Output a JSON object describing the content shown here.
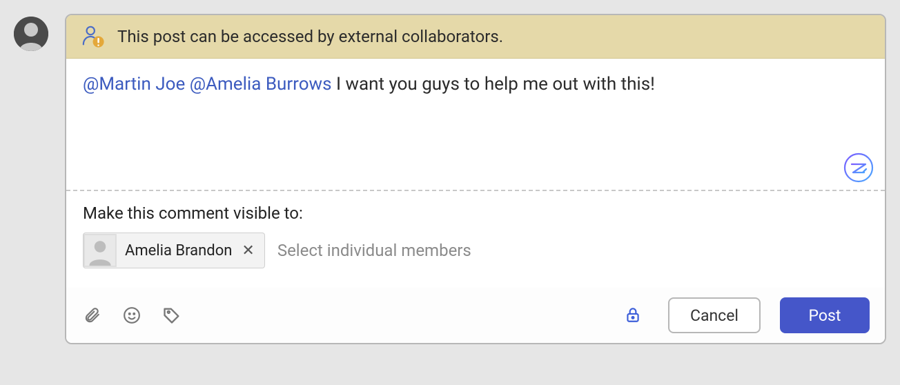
{
  "warning": {
    "text": "This post can be accessed by external collaborators."
  },
  "post": {
    "mentions": [
      "@Martin Joe",
      "@Amelia Burrows"
    ],
    "body_after_mentions": " I want you guys to help me out with this!"
  },
  "visibility": {
    "label": "Make this comment visible to:",
    "chips": [
      {
        "name": "Amelia Brandon"
      }
    ],
    "placeholder": "Select individual members"
  },
  "toolbar": {
    "cancel_label": "Cancel",
    "post_label": "Post"
  }
}
